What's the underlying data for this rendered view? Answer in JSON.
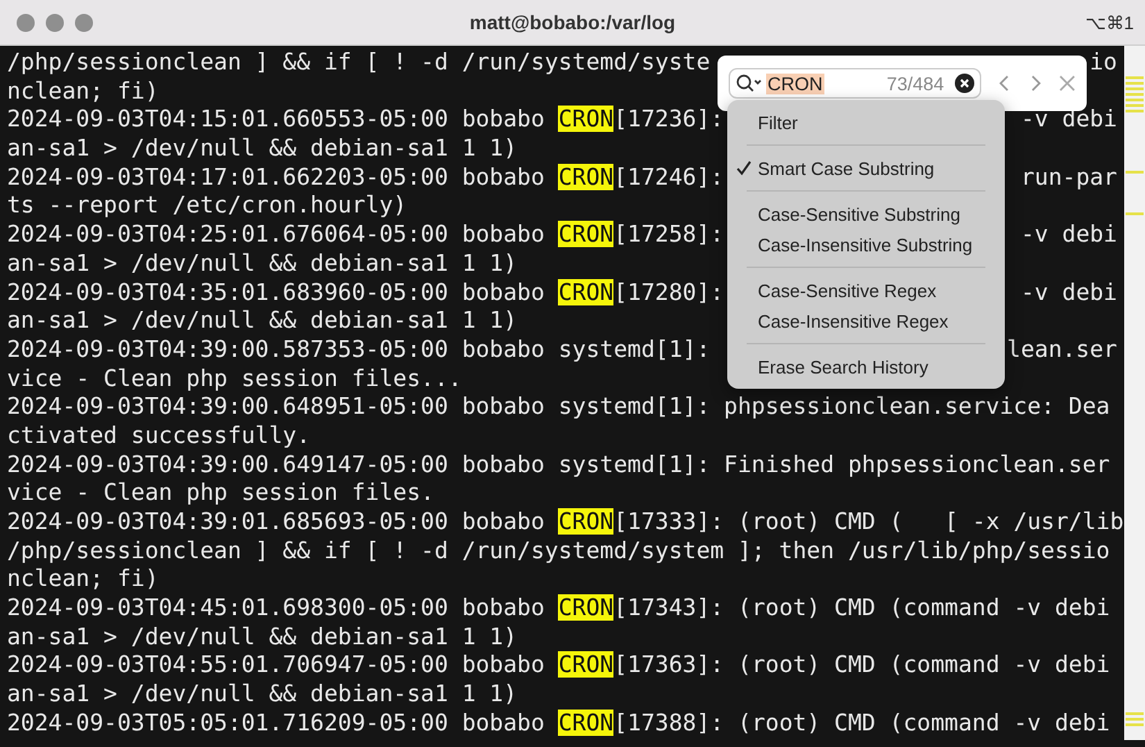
{
  "window": {
    "title": "matt@bobabo:/var/log",
    "shortcut": "⌥⌘1"
  },
  "terminal": {
    "lines": [
      {
        "segments": [
          {
            "text": "/php/sessionclean ] && if [ ! -d /run/systemd/syste",
            "match": false
          }
        ],
        "right": "io"
      },
      {
        "segments": [
          {
            "text": "nclean; fi)",
            "match": false
          }
        ]
      },
      {
        "segments": [
          {
            "text": "2024-09-03T04:15:01.660553-05:00 bobabo ",
            "match": false
          },
          {
            "text": "CRON",
            "match": true
          },
          {
            "text": "[17236]:",
            "match": false
          }
        ],
        "right": "-v debi"
      },
      {
        "segments": [
          {
            "text": "an-sa1 > /dev/null && debian-sa1 1 1)",
            "match": false
          }
        ]
      },
      {
        "segments": [
          {
            "text": "2024-09-03T04:17:01.662203-05:00 bobabo ",
            "match": false
          },
          {
            "text": "CRON",
            "match": true
          },
          {
            "text": "[17246]:",
            "match": false
          }
        ],
        "right": "run-par"
      },
      {
        "segments": [
          {
            "text": "ts --report /etc/cron.hourly)",
            "match": false
          }
        ]
      },
      {
        "segments": [
          {
            "text": "2024-09-03T04:25:01.676064-05:00 bobabo ",
            "match": false
          },
          {
            "text": "CRON",
            "match": true
          },
          {
            "text": "[17258]:",
            "match": false
          }
        ],
        "right": "-v debi"
      },
      {
        "segments": [
          {
            "text": "an-sa1 > /dev/null && debian-sa1 1 1)",
            "match": false
          }
        ]
      },
      {
        "segments": [
          {
            "text": "2024-09-03T04:35:01.683960-05:00 bobabo ",
            "match": false
          },
          {
            "text": "CRON",
            "match": true
          },
          {
            "text": "[17280]:",
            "match": false
          }
        ],
        "right": "-v debi"
      },
      {
        "segments": [
          {
            "text": "an-sa1 > /dev/null && debian-sa1 1 1)",
            "match": false
          }
        ]
      },
      {
        "segments": [
          {
            "text": "2024-09-03T04:39:00.587353-05:00 bobabo systemd[1]:",
            "match": false
          }
        ],
        "right": "lean.ser"
      },
      {
        "segments": [
          {
            "text": "vice - Clean php session files...",
            "match": false
          }
        ]
      },
      {
        "segments": [
          {
            "text": "2024-09-03T04:39:00.648951-05:00 bobabo systemd[1]: phpsessionclean.service: Dea",
            "match": false
          }
        ]
      },
      {
        "segments": [
          {
            "text": "ctivated successfully.",
            "match": false
          }
        ]
      },
      {
        "segments": [
          {
            "text": "2024-09-03T04:39:00.649147-05:00 bobabo systemd[1]: Finished phpsessionclean.ser",
            "match": false
          }
        ]
      },
      {
        "segments": [
          {
            "text": "vice - Clean php session files.",
            "match": false
          }
        ]
      },
      {
        "segments": [
          {
            "text": "2024-09-03T04:39:01.685693-05:00 bobabo ",
            "match": false
          },
          {
            "text": "CRON",
            "match": true
          },
          {
            "text": "[17333]: (root) CMD (   [ -x /usr/lib",
            "match": false
          }
        ]
      },
      {
        "segments": [
          {
            "text": "/php/sessionclean ] && if [ ! -d /run/systemd/system ]; then /usr/lib/php/sessio",
            "match": false
          }
        ]
      },
      {
        "segments": [
          {
            "text": "nclean; fi)",
            "match": false
          }
        ]
      },
      {
        "segments": [
          {
            "text": "2024-09-03T04:45:01.698300-05:00 bobabo ",
            "match": false
          },
          {
            "text": "CRON",
            "match": true
          },
          {
            "text": "[17343]: (root) CMD (command -v debi",
            "match": false
          }
        ]
      },
      {
        "segments": [
          {
            "text": "an-sa1 > /dev/null && debian-sa1 1 1)",
            "match": false
          }
        ]
      },
      {
        "segments": [
          {
            "text": "2024-09-03T04:55:01.706947-05:00 bobabo ",
            "match": false
          },
          {
            "text": "CRON",
            "match": true
          },
          {
            "text": "[17363]: (root) CMD (command -v debi",
            "match": false
          }
        ]
      },
      {
        "segments": [
          {
            "text": "an-sa1 > /dev/null && debian-sa1 1 1)",
            "match": false
          }
        ]
      },
      {
        "segments": [
          {
            "text": "2024-09-03T05:05:01.716209-05:00 bobabo ",
            "match": false
          },
          {
            "text": "CRON",
            "match": true
          },
          {
            "text": "[17388]: (root) CMD (command -v debi",
            "match": false
          }
        ]
      }
    ]
  },
  "find_bar": {
    "query": "CRON",
    "count": "73/484"
  },
  "search_menu": {
    "groups": [
      [
        {
          "label": "Filter",
          "checked": false
        }
      ],
      [
        {
          "label": "Smart Case Substring",
          "checked": true
        }
      ],
      [
        {
          "label": "Case-Sensitive Substring",
          "checked": false
        },
        {
          "label": "Case-Insensitive Substring",
          "checked": false
        }
      ],
      [
        {
          "label": "Case-Sensitive Regex",
          "checked": false
        },
        {
          "label": "Case-Insensitive Regex",
          "checked": false
        }
      ],
      [
        {
          "label": "Erase Search History",
          "checked": false
        }
      ]
    ]
  }
}
